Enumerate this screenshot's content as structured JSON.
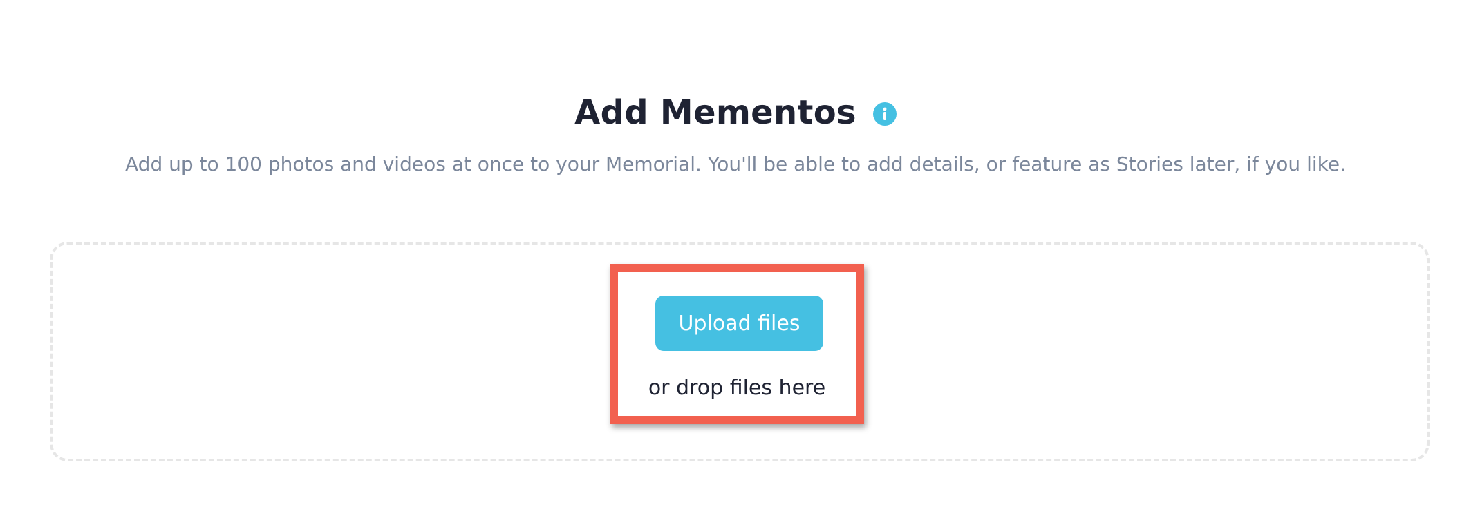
{
  "header": {
    "title": "Add Mementos",
    "info_icon": "info-icon",
    "subtitle": "Add up to 100 photos and videos at once to your Memorial. You'll be able to add details, or feature as Stories later, if you like."
  },
  "dropzone": {
    "upload_button_label": "Upload files",
    "drop_hint": "or drop files here"
  },
  "colors": {
    "accent": "#45c0e2",
    "highlight": "#f2604f",
    "title": "#1f2333",
    "subtitle": "#7b879b",
    "dropzone_border": "#e6e6e6"
  }
}
